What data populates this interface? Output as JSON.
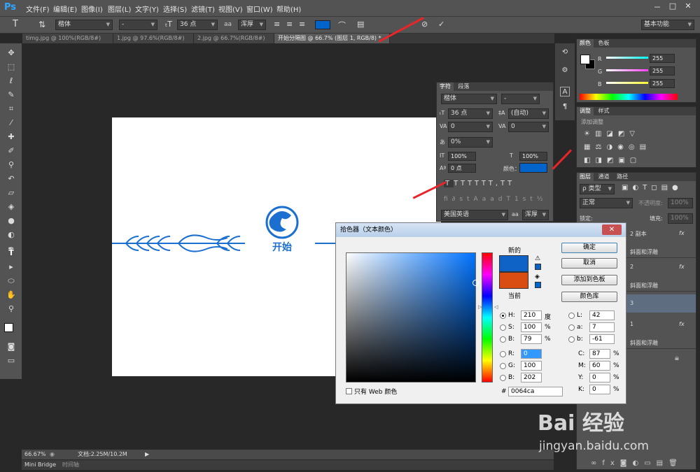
{
  "app": {
    "logo": "Ps"
  },
  "menu": [
    "文件(F)",
    "编辑(E)",
    "图像(I)",
    "图层(L)",
    "文字(Y)",
    "选择(S)",
    "滤镜(T)",
    "视图(V)",
    "窗口(W)",
    "帮助(H)"
  ],
  "window_buttons": [
    "－",
    "□",
    "✕"
  ],
  "options": {
    "font_family": "楷体",
    "font_style": "-",
    "font_size": "36 点",
    "aa_label": "aa",
    "aa_mode": "浑厚",
    "workspace": "基本功能",
    "text_color": "#0064ca"
  },
  "tabs": [
    "timg.jpg @ 100%(RGB/8#)",
    "1.jpg @ 97.6%(RGB/8#)",
    "2.jpg @ 66.7%(RGB/8#)",
    "开始分隔图 @ 66.7% (图层 1, RGB/8) *"
  ],
  "document": {
    "text": "开始",
    "ornament_color": "#1a6fd1"
  },
  "status": {
    "zoom": "66.67%",
    "doc": "文档:2.25M/10.2M"
  },
  "bottom_tabs": [
    "Mini Bridge",
    "时间轴"
  ],
  "character_panel": {
    "tabs": [
      "字符",
      "段落"
    ],
    "font_family": "楷体",
    "font_style": "-",
    "size": "36 点",
    "leading": "(自动)",
    "kerning": "0",
    "tracking": "0",
    "scale_label": "0%",
    "vscale": "100%",
    "hscale": "100%",
    "baseline": "0 点",
    "color_label": "颜色：",
    "language": "美国英语",
    "aa_label": "aa",
    "aa_mode": "浑厚",
    "swatch": "#0064ca"
  },
  "color_panel": {
    "tabs": [
      "颜色",
      "色板"
    ],
    "channels": [
      {
        "name": "R",
        "value": "255",
        "color": "#00ffff"
      },
      {
        "name": "G",
        "value": "255",
        "color": "#ff40ff"
      },
      {
        "name": "B",
        "value": "255",
        "color": "#ffff33"
      }
    ]
  },
  "adjust_panel": {
    "tabs": [
      "调整",
      "样式"
    ],
    "title": "添加调整"
  },
  "layers_panel": {
    "tabs": [
      "图层",
      "通道",
      "路径"
    ],
    "filter": "ρ 类型",
    "blend": "正常",
    "opacity_label": "不透明度:",
    "opacity": "100%",
    "lock_label": "锁定:",
    "fill_label": "填充:",
    "fill": "100%",
    "layers": [
      {
        "name": "2 副本",
        "sub": "斜面和浮雕"
      },
      {
        "name": "2",
        "sub": "斜面和浮雕"
      },
      {
        "name": "3",
        "sub": ""
      },
      {
        "name": "1",
        "sub": "斜面和浮雕"
      }
    ],
    "fx": "fx"
  },
  "dialog": {
    "title": "拾色器（文本颜色）",
    "close": "✕",
    "new_label": "新的",
    "current_label": "当前",
    "new_color": "#0f62c6",
    "current_color": "#d94d12",
    "buttons": [
      "确定",
      "取消",
      "添加到色板",
      "颜色库"
    ],
    "hsb": [
      {
        "k": "H:",
        "v": "210",
        "u": "度"
      },
      {
        "k": "S:",
        "v": "100",
        "u": "%"
      },
      {
        "k": "B:",
        "v": "79",
        "u": "%"
      }
    ],
    "rgb": [
      {
        "k": "R:",
        "v": "0"
      },
      {
        "k": "G:",
        "v": "100"
      },
      {
        "k": "B:",
        "v": "202"
      }
    ],
    "lab": [
      {
        "k": "L:",
        "v": "42"
      },
      {
        "k": "a:",
        "v": "7"
      },
      {
        "k": "b:",
        "v": "-61"
      }
    ],
    "cmyk": [
      {
        "k": "C:",
        "v": "87",
        "u": "%"
      },
      {
        "k": "M:",
        "v": "60",
        "u": "%"
      },
      {
        "k": "Y:",
        "v": "0",
        "u": "%"
      },
      {
        "k": "K:",
        "v": "0",
        "u": "%"
      }
    ],
    "hex_label": "#",
    "hex": "0064ca",
    "web_only": "只有 Web 颜色"
  },
  "watermark": {
    "brand": "Bai 经验",
    "url": "jingyan.baidu.com"
  }
}
